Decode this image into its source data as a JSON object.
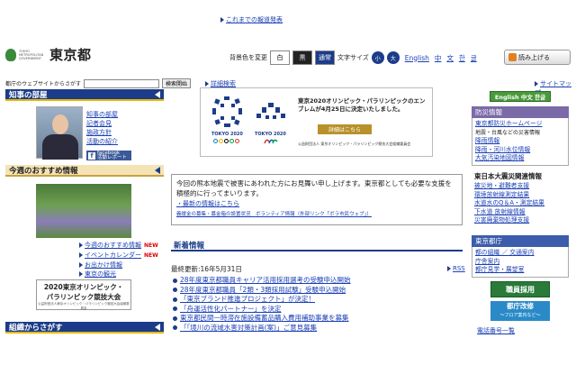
{
  "header": {
    "logo_small": "TOKYO METROPOLITAN GOVERNMENT",
    "logo_big": "東京都",
    "bg_color_label": "背景色を変更",
    "bg_white": "白",
    "bg_black": "黒",
    "bg_normal": "通常",
    "font_size_label": "文字サイズ",
    "font_small": "小",
    "font_large": "大",
    "lang_english": "English",
    "lang_chinese1": "中",
    "lang_chinese2": "文",
    "lang_korean1": "한",
    "lang_korean2": "글",
    "read_aloud": "読み上げる"
  },
  "search": {
    "label": "都庁のウェブサイトからさがす",
    "button": "検索開始",
    "detail": "詳細検索",
    "sitemap": "サイトマップ"
  },
  "left": {
    "governor_title": "知事の部屋",
    "governor_links": [
      "知事の部屋",
      "記者会見",
      "施政方針",
      "活動の紹介"
    ],
    "facebook": "facebook",
    "facebook_sub": "活動レポート",
    "recommend_title": "今週のおすすめ情報",
    "recommend_links": [
      {
        "text": "今週のおすすめ情報",
        "new": "NEW"
      },
      {
        "text": "イベントカレンダー",
        "new": "NEW"
      },
      {
        "text": "お出かけ情報",
        "new": ""
      },
      {
        "text": "東京の観光",
        "new": ""
      }
    ],
    "oly_banner_line1": "2020東京オリンピック・",
    "oly_banner_line2": "パラリンピック競技大会",
    "oly_banner_tiny": "公益財団法人東京オリンピック・パラリンピック競技大会組織委員会",
    "org_title": "組織からさがす"
  },
  "emblem": {
    "olympic_label": "TOKYO 2020",
    "paralympic_label": "TOKYO 2020",
    "text": "東京2020オリンピック・パラリンピックのエンブレムが4月25日に決定いたしました。",
    "detail_button": "詳細はこちら",
    "org": "公益財団法人 東京オリンピック・パラリンピック競技大会組織委員会"
  },
  "message": {
    "text": "今回の熊本地震で被害にあわれた方にお見舞い申し上げます。東京都としても必要な支援を積極的に行ってまいります。",
    "link": "・最新の情報はこちら",
    "sub_links": "義援金の募集・募金箱の設置状況　ボランティア情報（外部リンク「ボラ市民ウェブ」）"
  },
  "news": {
    "title": "新着情報",
    "more": "これまでの報道発表",
    "updated": "最終更新:16年5月31日",
    "rss": "RSS",
    "items": [
      "28年度東京都職員キャリア活用採用選考の受験申込開始",
      "28年度東京都職員「2類・3類採用試験」受験申込開始",
      "「東京ブランド推進プロジェクト」が決定！",
      "「舟運活性化パートナー」を決定",
      "東京都民間一時滞在施設備蓄品購入費用補助事業を募集",
      "「「境川の流域水害対策計画(案)」ご意見募集"
    ]
  },
  "right": {
    "english_button": "English 中文 한글",
    "disaster_title": "防災情報",
    "disaster_links": [
      {
        "text": "東京都防災ホームページ",
        "type": "link"
      },
      {
        "text": "地震・台風などの災害情報",
        "type": "plain"
      },
      {
        "text": "降雨情報",
        "type": "link"
      },
      {
        "text": "降雨・河川水位情報",
        "type": "link"
      },
      {
        "text": "大気汚染地図情報",
        "type": "link"
      }
    ],
    "quake_title": "東日本大震災関連情報",
    "quake_links": [
      "被災地・避難者支援",
      "環境放射線測定結果",
      "水道水のQ＆A・測定結果",
      "下水道 放射線情報",
      "災害廃棄物処理支援"
    ],
    "office_title": "東京都庁",
    "office_links": [
      "都の組織 ／ 交通案内",
      "庁舎案内",
      "都庁見学・展望室"
    ],
    "job_banner": "職員採用",
    "reform_banner": "都庁改修",
    "reform_sub": "〜フロア案内など〜",
    "tel": "電話番号一覧"
  },
  "colors": {
    "navy": "#1c3c8a",
    "gold": "#e8b800",
    "link": "#1a3fb5",
    "disaster_purple": "#7a6aa8",
    "green": "#4a9a3a"
  }
}
